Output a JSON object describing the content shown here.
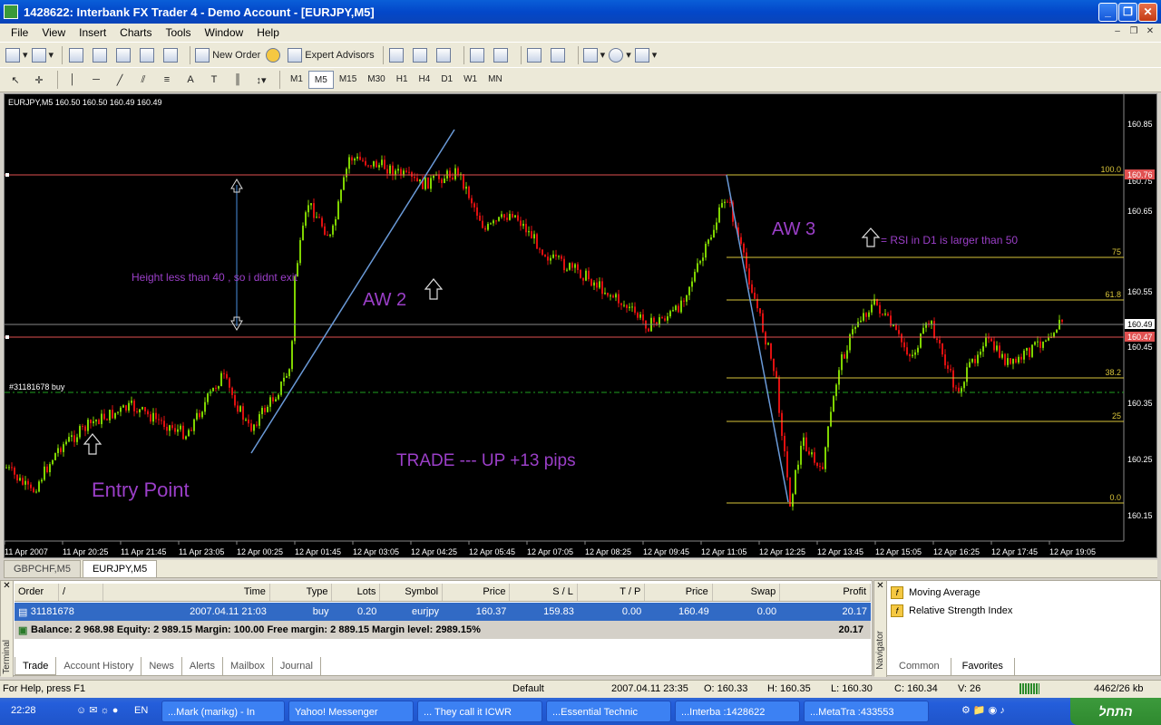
{
  "window": {
    "title": "1428622: Interbank FX Trader 4 - Demo Account - [EURJPY,M5]",
    "controls": [
      "_",
      "❐",
      "✕"
    ]
  },
  "menu": {
    "items": [
      "File",
      "View",
      "Insert",
      "Charts",
      "Tools",
      "Window",
      "Help"
    ]
  },
  "toolbar1": {
    "new_order": "New Order",
    "expert_advisors": "Expert Advisors"
  },
  "toolbar2": {
    "timeframes": [
      "M1",
      "M5",
      "M15",
      "M30",
      "H1",
      "H4",
      "D1",
      "W1",
      "MN"
    ],
    "selected": "M5"
  },
  "chart": {
    "header": "EURJPY,M5  160.50 160.50 160.49 160.49",
    "price_ticks": [
      "160.85",
      "160.75",
      "160.65",
      "160.55",
      "160.45",
      "160.35",
      "160.25",
      "160.15"
    ],
    "time_ticks": [
      "11 Apr 2007",
      "11 Apr 20:25",
      "11 Apr 21:45",
      "11 Apr 23:05",
      "12 Apr 00:25",
      "12 Apr 01:45",
      "12 Apr 03:05",
      "12 Apr 04:25",
      "12 Apr 05:45",
      "12 Apr 07:05",
      "12 Apr 08:25",
      "12 Apr 09:45",
      "12 Apr 11:05",
      "12 Apr 12:25",
      "12 Apr 13:45",
      "12 Apr 15:05",
      "12 Apr 16:25",
      "12 Apr 17:45",
      "12 Apr 19:05"
    ],
    "price_labels": {
      "upper": "160.76",
      "current": "160.49",
      "lower": "160.47"
    },
    "fib_levels": [
      "100.0",
      "75",
      "61.8",
      "38.2",
      "25",
      "0.0"
    ],
    "order_label": "#31181678 buy",
    "annotations": {
      "height_note": "Height less than 40 , so i didnt exit",
      "aw2": "AW 2",
      "aw3": "AW 3",
      "rsi_note": "= RSI in D1 is larger than 50",
      "trade": "TRADE --- UP +13 pips",
      "entry": "Entry Point"
    },
    "colors": {
      "bull": "#7fd400",
      "bear": "#e01010",
      "annotation": "#9b3fc8",
      "fib": "#d8c43a"
    }
  },
  "symbol_tabs": [
    "GBPCHF,M5",
    "EURJPY,M5"
  ],
  "terminal": {
    "side_label": "Terminal",
    "columns": [
      "Order",
      "/",
      "Time",
      "Type",
      "Lots",
      "Symbol",
      "Price",
      "S / L",
      "T / P",
      "Price",
      "Swap",
      "Profit"
    ],
    "row": {
      "order": "31181678",
      "time": "2007.04.11 21:03",
      "type": "buy",
      "lots": "0.20",
      "symbol": "eurjpy",
      "price": "160.37",
      "sl": "159.83",
      "tp": "0.00",
      "cur_price": "160.49",
      "swap": "0.00",
      "profit": "20.17"
    },
    "balance": "Balance: 2 968.98  Equity: 2 989.15  Margin: 100.00  Free margin: 2 889.15  Margin level: 2989.15%",
    "balance_profit": "20.17",
    "tabs": [
      "Trade",
      "Account History",
      "News",
      "Alerts",
      "Mailbox",
      "Journal"
    ]
  },
  "navigator": {
    "side_label": "Navigator",
    "items": [
      "Moving Average",
      "Relative Strength Index"
    ],
    "tabs": [
      "Common",
      "Favorites"
    ]
  },
  "status": {
    "help": "For Help, press F1",
    "profile": "Default",
    "datetime": "2007.04.11 23:35",
    "open": "O: 160.33",
    "high": "H: 160.35",
    "low": "L: 160.30",
    "close": "C: 160.34",
    "volume": "V: 26",
    "traffic": "4462/26 kb"
  },
  "taskbar": {
    "time": "22:28",
    "lang": "EN",
    "items": [
      "...Mark (marikg) - In",
      "Yahoo! Messenger",
      "... They call it ICWR",
      "...Essential Technic",
      "...Interba :1428622",
      "...MetaTra :433553"
    ],
    "start": "התחל"
  }
}
